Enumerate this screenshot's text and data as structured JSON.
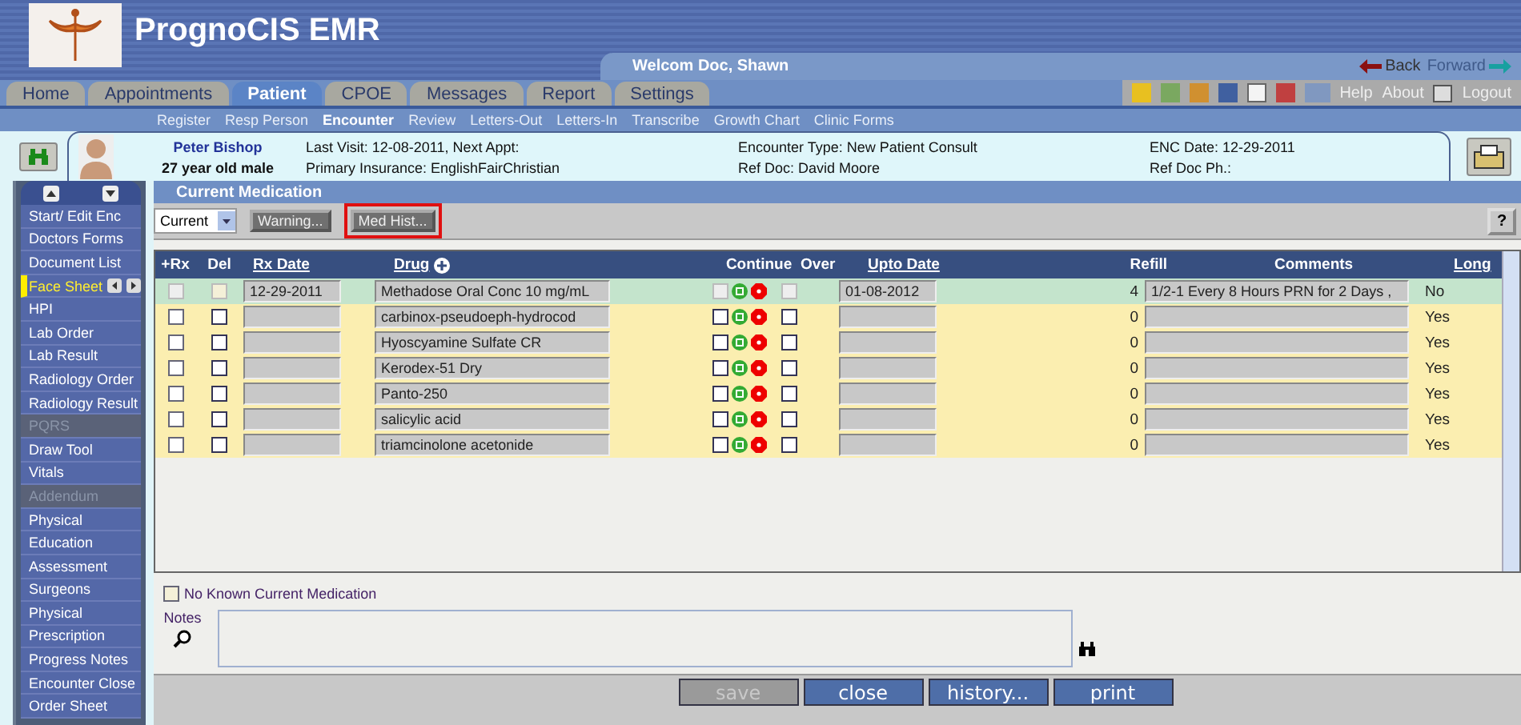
{
  "app": {
    "title": "PrognoCIS EMR",
    "welcome": "Welcom Doc, Shawn"
  },
  "nav_links": [
    {
      "label": "Back",
      "kind": "back",
      "disabled": false
    },
    {
      "label": "Forward",
      "kind": "forward",
      "disabled": true
    }
  ],
  "tabs": [
    {
      "label": "Home",
      "selected": false
    },
    {
      "label": "Appointments",
      "selected": false
    },
    {
      "label": "Patient",
      "selected": true
    },
    {
      "label": "CPOE",
      "selected": false
    },
    {
      "label": "Messages",
      "selected": false
    },
    {
      "label": "Report",
      "selected": false
    },
    {
      "label": "Settings",
      "selected": false
    }
  ],
  "top_links": [
    "Help",
    "About",
    "Logout"
  ],
  "subnav": [
    {
      "label": "Register",
      "selected": false
    },
    {
      "label": "Resp Person",
      "selected": false
    },
    {
      "label": "Encounter",
      "selected": true
    },
    {
      "label": "Review",
      "selected": false
    },
    {
      "label": "Letters-Out",
      "selected": false
    },
    {
      "label": "Letters-In",
      "selected": false
    },
    {
      "label": "Transcribe",
      "selected": false
    },
    {
      "label": "Growth Chart",
      "selected": false
    },
    {
      "label": "Clinic Forms",
      "selected": false
    }
  ],
  "patient": {
    "name": "Peter Bishop",
    "age_sex": "27 year old male",
    "last_visit": "Last Visit: 12-08-2011, Next Appt:",
    "insurance": "Primary Insurance: EnglishFairChristian",
    "encounter_type": "Encounter Type: New Patient Consult",
    "ref_doc": "Ref Doc: David Moore",
    "enc_date": "ENC Date: 12-29-2011",
    "ref_doc_ph": "Ref Doc Ph.:"
  },
  "sidebar": {
    "items": [
      {
        "label": "Start/ Edit Enc",
        "selected": false,
        "disabled": false
      },
      {
        "label": "Doctors Forms",
        "selected": false,
        "disabled": false
      },
      {
        "label": "Document List",
        "selected": false,
        "disabled": false
      },
      {
        "label": "Face Sheet",
        "selected": true,
        "disabled": false
      },
      {
        "label": "HPI",
        "selected": false,
        "disabled": false
      },
      {
        "label": "Lab Order",
        "selected": false,
        "disabled": false
      },
      {
        "label": "Lab Result",
        "selected": false,
        "disabled": false
      },
      {
        "label": "Radiology Order",
        "selected": false,
        "disabled": false
      },
      {
        "label": "Radiology Result",
        "selected": false,
        "disabled": false
      },
      {
        "label": "PQRS",
        "selected": false,
        "disabled": true
      },
      {
        "label": "Draw Tool",
        "selected": false,
        "disabled": false
      },
      {
        "label": "Vitals",
        "selected": false,
        "disabled": false
      },
      {
        "label": "Addendum",
        "selected": false,
        "disabled": true
      },
      {
        "label": "Physical",
        "selected": false,
        "disabled": false
      },
      {
        "label": "Education",
        "selected": false,
        "disabled": false
      },
      {
        "label": "Assessment",
        "selected": false,
        "disabled": false
      },
      {
        "label": "Surgeons",
        "selected": false,
        "disabled": false
      },
      {
        "label": "Physical",
        "selected": false,
        "disabled": false
      },
      {
        "label": "Prescription",
        "selected": false,
        "disabled": false
      },
      {
        "label": "Progress Notes",
        "selected": false,
        "disabled": false
      },
      {
        "label": "Encounter Close",
        "selected": false,
        "disabled": false
      },
      {
        "label": "Order Sheet",
        "selected": false,
        "disabled": false
      }
    ]
  },
  "panel": {
    "title": "Current Medication",
    "filter": "Current",
    "buttons": [
      {
        "label": "Warning...",
        "highlighted": false
      },
      {
        "label": "Med Hist...",
        "highlighted": true
      }
    ],
    "help": "?"
  },
  "table": {
    "columns": [
      {
        "label": "+Rx",
        "sortable": false
      },
      {
        "label": "Del",
        "sortable": false
      },
      {
        "label": "Rx Date",
        "sortable": true
      },
      {
        "label": "Drug",
        "sortable": true
      },
      {
        "label": "Continue",
        "sortable": false
      },
      {
        "label": "Over",
        "sortable": false
      },
      {
        "label": "Upto Date",
        "sortable": true
      },
      {
        "label": "Refill",
        "sortable": false
      },
      {
        "label": "Comments",
        "sortable": false
      },
      {
        "label": "Long",
        "sortable": true
      }
    ],
    "rows": [
      {
        "selected": true,
        "rx_checked": false,
        "del_checked": false,
        "rx_date": "12-29-2011",
        "drug": "Methadose Oral Conc 10 mg/mL",
        "continue_checked": false,
        "over_checked": false,
        "upto_date": "01-08-2012",
        "refill": "4",
        "comments": "1/2-1 Every 8 Hours PRN  for 2 Days ,",
        "long": "No"
      },
      {
        "selected": false,
        "rx_checked": false,
        "del_checked": false,
        "rx_date": "",
        "drug": "carbinox-pseudoeph-hydrocod",
        "continue_checked": false,
        "over_checked": false,
        "upto_date": "",
        "refill": "0",
        "comments": "",
        "long": "Yes"
      },
      {
        "selected": false,
        "rx_checked": false,
        "del_checked": false,
        "rx_date": "",
        "drug": "Hyoscyamine Sulfate CR",
        "continue_checked": false,
        "over_checked": false,
        "upto_date": "",
        "refill": "0",
        "comments": "",
        "long": "Yes"
      },
      {
        "selected": false,
        "rx_checked": false,
        "del_checked": false,
        "rx_date": "",
        "drug": "Kerodex-51 Dry",
        "continue_checked": false,
        "over_checked": false,
        "upto_date": "",
        "refill": "0",
        "comments": "",
        "long": "Yes"
      },
      {
        "selected": false,
        "rx_checked": false,
        "del_checked": false,
        "rx_date": "",
        "drug": "Panto-250",
        "continue_checked": false,
        "over_checked": false,
        "upto_date": "",
        "refill": "0",
        "comments": "",
        "long": "Yes"
      },
      {
        "selected": false,
        "rx_checked": false,
        "del_checked": false,
        "rx_date": "",
        "drug": "salicylic acid",
        "continue_checked": false,
        "over_checked": false,
        "upto_date": "",
        "refill": "0",
        "comments": "",
        "long": "Yes"
      },
      {
        "selected": false,
        "rx_checked": false,
        "del_checked": false,
        "rx_date": "",
        "drug": "triamcinolone acetonide",
        "continue_checked": false,
        "over_checked": false,
        "upto_date": "",
        "refill": "0",
        "comments": "",
        "long": "Yes"
      }
    ]
  },
  "no_known": {
    "label": "No Known Current Medication",
    "checked": false
  },
  "notes": {
    "label": "Notes"
  },
  "actions": [
    {
      "label": "save",
      "disabled": true
    },
    {
      "label": "close",
      "disabled": false
    },
    {
      "label": "history...",
      "disabled": false
    },
    {
      "label": "print",
      "disabled": false
    }
  ]
}
